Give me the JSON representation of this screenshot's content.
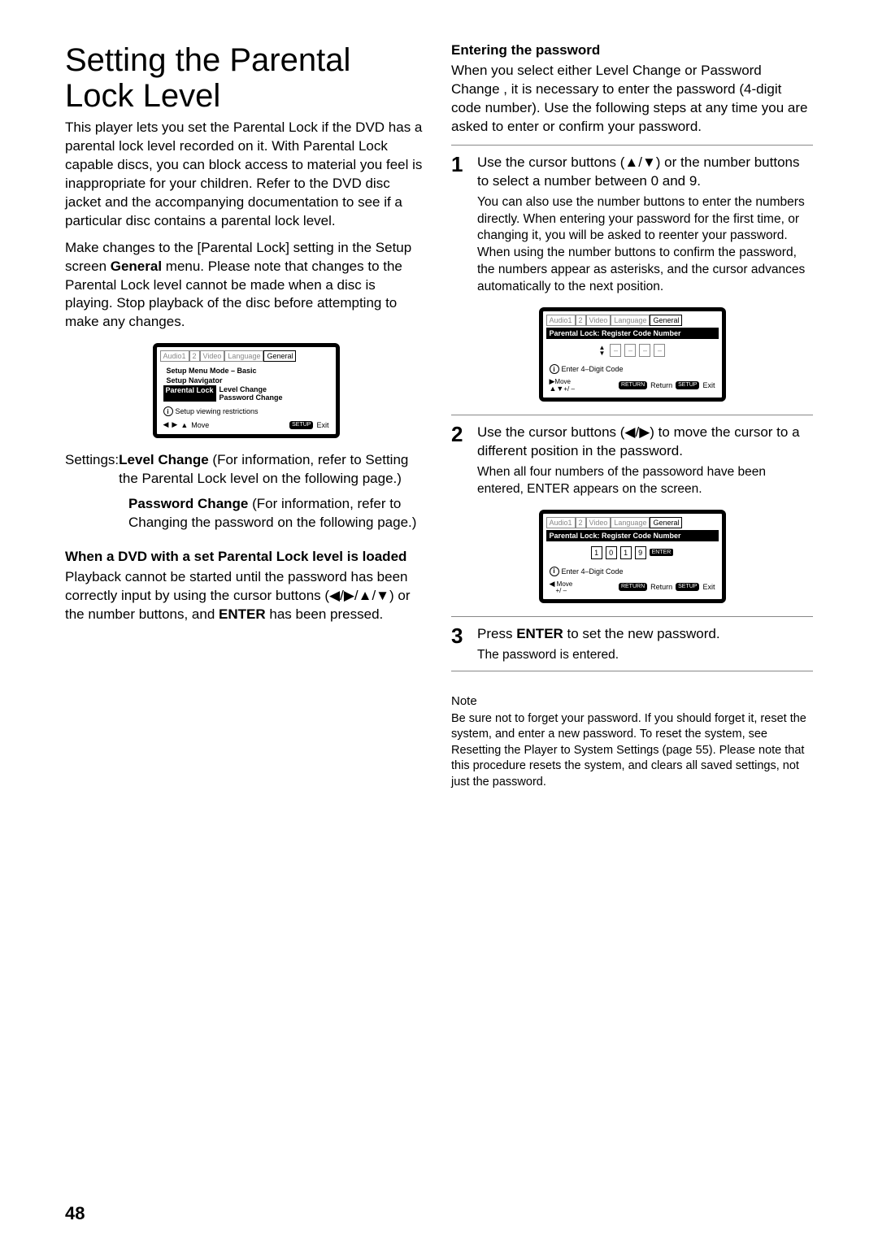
{
  "title": "Setting the Parental Lock Level",
  "intro1": "This player lets you set the Parental Lock if the DVD has a parental lock level recorded on it. With Parental Lock capable discs, you can block access to material you feel is inappropriate for your children. Refer to the DVD disc jacket and the accompanying documentation to see if a particular disc contains a parental lock level.",
  "intro2_a": "Make changes to the [Parental Lock] setting in the Setup screen ",
  "intro2_b": "General",
  "intro2_c": " menu. Please note that changes to the Parental Lock level cannot be made when a disc is playing. Stop playback of the disc before attempting to make any changes.",
  "osd1": {
    "tabs": [
      "Audio1",
      "2",
      "Video",
      "Language",
      "General"
    ],
    "line1": "Setup Menu Mode – Basic",
    "line2": "Setup Navigator",
    "rowLabel": "Parental Lock",
    "opt1": "Level Change",
    "opt2": "Password Change",
    "info": "Setup viewing restrictions",
    "footMove": "Move",
    "footSetup": "SETUP",
    "footExit": "Exit"
  },
  "settings_label": "Settings:",
  "setting1_name": "Level Change",
  "setting1_desc": " (For information, refer to Setting the Parental Lock level on the following page.)",
  "setting2_name": "Password Change",
  "setting2_desc": " (For information, refer to Changing the password on the following page.)",
  "sub_heading": "When a DVD with a set Parental Lock level is loaded",
  "sub_text_a": "Playback cannot be started until the password has been correctly input by using the cursor buttons (◀/▶/▲/▼) or the number buttons, and ",
  "sub_text_enter": "ENTER",
  "sub_text_b": " has been pressed.",
  "right_heading": "Entering the password",
  "right_intro": "When you select either Level Change or Password Change , it is necessary to enter the password (4-digit code number). Use the following steps at any time you are asked to enter or confirm your password.",
  "step1_a": "Use the cursor buttons (▲/▼) or the number buttons to select a number between 0 and 9.",
  "step1_b": "You can also use the number buttons to enter the numbers directly. When entering your password for the first time, or changing it, you will be asked to reenter your password. When using the number buttons to confirm the password, the numbers appear as asterisks, and the cursor advances automatically to the next position.",
  "osd2": {
    "header": "Parental Lock: Register Code Number",
    "info": "Enter 4–Digit Code",
    "move": "Move",
    "plusminus": "+/ –",
    "return": "Return",
    "returnPill": "RETURN",
    "setupPill": "SETUP",
    "exit": "Exit",
    "tabs": [
      "Audio1",
      "2",
      "Video",
      "Language",
      "General"
    ]
  },
  "step2_a": "Use the cursor buttons (◀/▶) to move the cursor to a different position in the password.",
  "step2_b": "When all four numbers of the passoword have been entered, ENTER appears on the screen.",
  "osd3": {
    "header": "Parental Lock: Register Code Number",
    "digits": [
      "1",
      "0",
      "1",
      "9"
    ],
    "enter": "ENTER",
    "info": "Enter 4–Digit Code",
    "move": "Move",
    "plusminus": "+/ –",
    "return": "Return",
    "returnPill": "RETURN",
    "setupPill": "SETUP",
    "exit": "Exit",
    "tabs": [
      "Audio1",
      "2",
      "Video",
      "Language",
      "General"
    ]
  },
  "step3_a": "Press ",
  "step3_enter": "ENTER",
  "step3_b": " to set the new password.",
  "step3_c": "The password is entered.",
  "note_label": "Note",
  "note_text": "Be sure not to forget your password. If you should forget it, reset the system, and enter a new password. To reset the system, see Resetting the Player to System Settings (page 55). Please note that this procedure resets the system, and clears all saved settings, not just the password.",
  "page_number": "48"
}
